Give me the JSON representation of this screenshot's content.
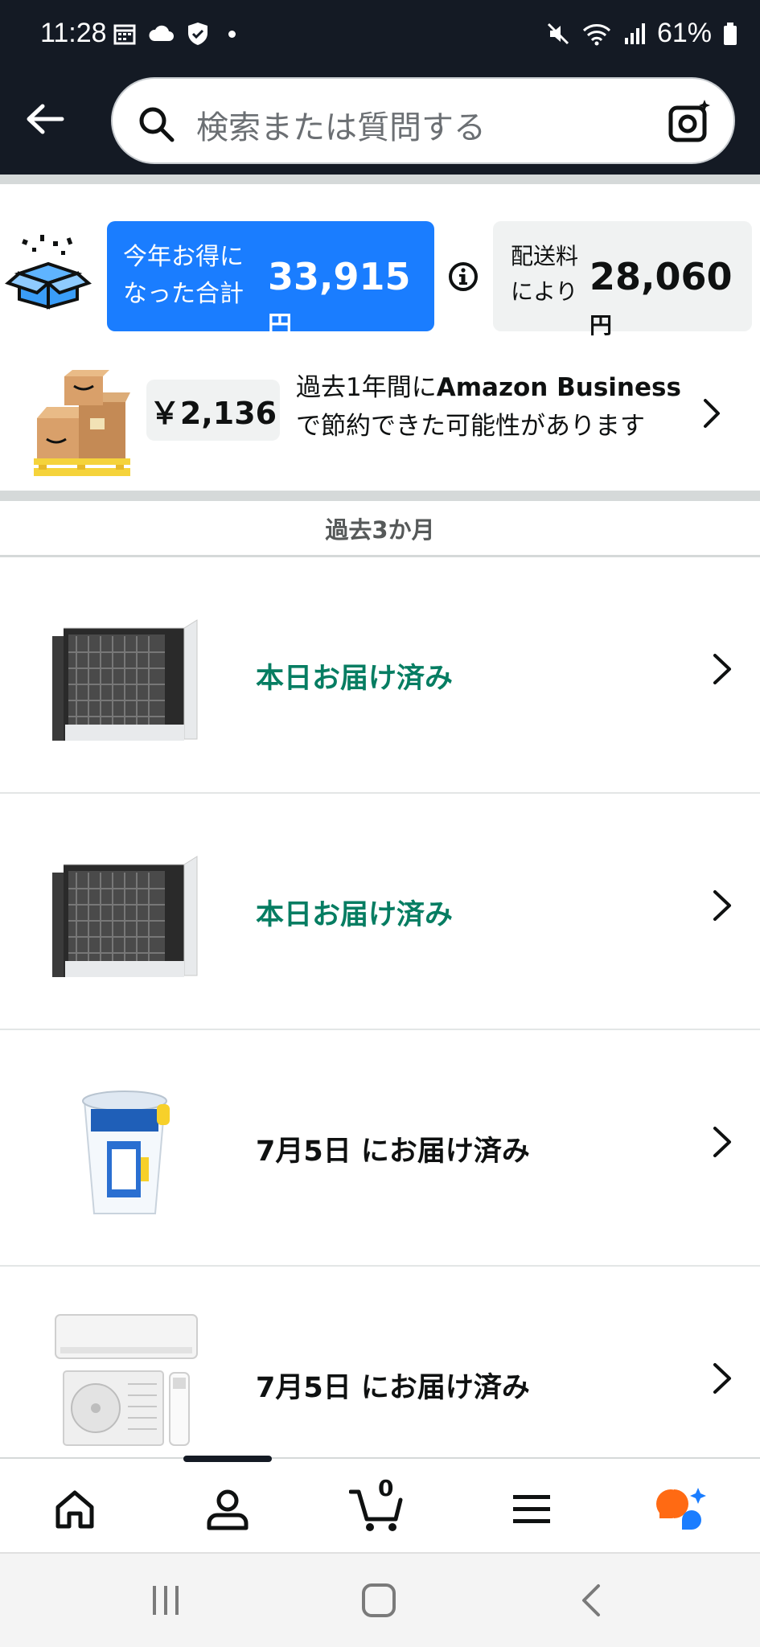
{
  "status_bar": {
    "time": "11:28",
    "battery": "61%"
  },
  "search": {
    "placeholder": "検索または質問する"
  },
  "savings": {
    "label_line1": "今年お得に",
    "label_line2": "なった合計",
    "amount": "33,915",
    "yen": "円",
    "shipping_line1": "配送料",
    "shipping_line2": "により",
    "shipping_amount": "28,060",
    "shipping_yen": "円"
  },
  "business": {
    "amount": "￥2,136",
    "text_prefix": "過去1年間に",
    "text_bold": "Amazon Business",
    "text_line2": "で節約できた可能性があります"
  },
  "section": {
    "title": "過去3か月"
  },
  "orders": [
    {
      "status": "本日お届け済み",
      "color": "#067d62",
      "product": "air-conditioner-cover"
    },
    {
      "status": "本日お届け済み",
      "color": "#067d62",
      "product": "air-conditioner-cover"
    },
    {
      "status": "7月5日 にお届け済み",
      "color": "#0f1111",
      "product": "ice-cup"
    },
    {
      "status": "7月5日 にお届け済み",
      "color": "#0f1111",
      "product": "air-conditioner-set"
    }
  ],
  "bottom_nav": {
    "items": [
      "home-icon",
      "account-icon",
      "cart-icon",
      "menu-icon",
      "assistant-icon"
    ],
    "cart_count": "0"
  },
  "colors": {
    "header_bg": "#141a24",
    "accent_blue": "#1a7dff",
    "delivered_green": "#067d62"
  }
}
